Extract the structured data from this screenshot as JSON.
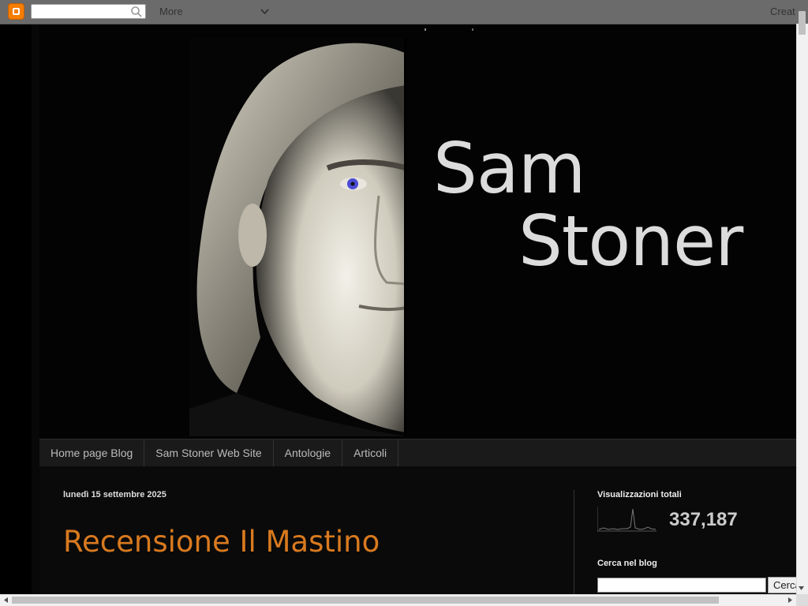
{
  "navbar": {
    "more_label": "More",
    "create_label": "Creat",
    "search_placeholder": ""
  },
  "header": {
    "title_line1": "Sam",
    "title_line2": "Stoner"
  },
  "tabs": [
    {
      "label": "Home page Blog"
    },
    {
      "label": "Sam Stoner Web Site"
    },
    {
      "label": "Antologie"
    },
    {
      "label": "Articoli"
    }
  ],
  "post": {
    "date": "lunedì 15 settembre 2025",
    "title": "Recensione Il Mastino"
  },
  "sidebar": {
    "views_title": "Visualizzazioni totali",
    "views_count": "337,187",
    "search_title": "Cerca nel blog",
    "search_button": "Cerca",
    "search_value": ""
  },
  "colors": {
    "accent": "#d97a1f",
    "background": "#000000",
    "navbar": "#6b6b6b"
  }
}
